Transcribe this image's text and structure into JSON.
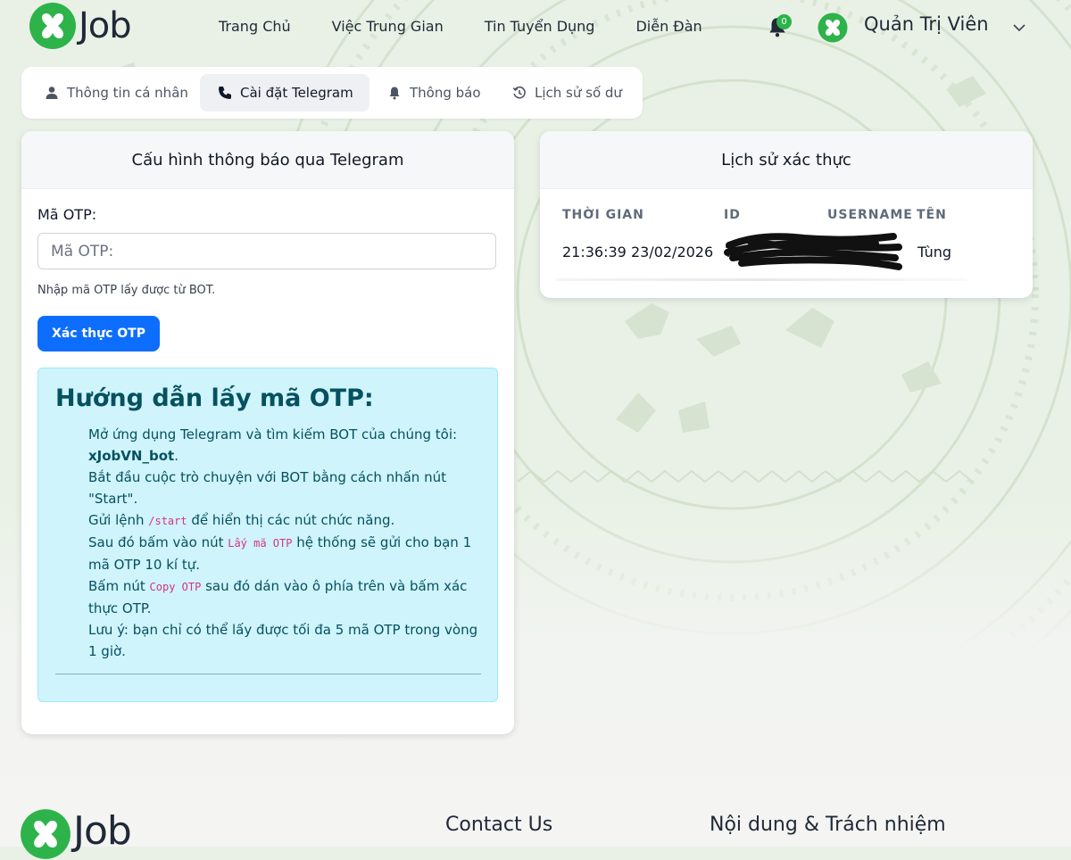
{
  "brand": {
    "logo_text": "Job",
    "accent": "#2db34a"
  },
  "nav": {
    "links": [
      "Trang Chủ",
      "Việc Trung Gian",
      "Tin Tuyển Dụng",
      "Diễn Đàn"
    ],
    "notification_count": "0",
    "user_name": "Quản Trị Viên",
    "icons": {
      "bell": "bell-icon",
      "dropdown": "chevron-down-icon",
      "avatar": "x-avatar-icon"
    }
  },
  "tabs": [
    {
      "label": "Thông tin cá nhân",
      "icon": "user-icon",
      "active": false
    },
    {
      "label": "Cài đặt Telegram",
      "icon": "phone-icon",
      "active": true
    },
    {
      "label": "Thông báo",
      "icon": "bell-icon",
      "active": false
    },
    {
      "label": "Lịch sử số dư",
      "icon": "history-icon",
      "active": false
    }
  ],
  "otp_card": {
    "title": "Cấu hình thông báo qua Telegram",
    "field_label": "Mã OTP:",
    "placeholder": "Mã OTP:",
    "value": "",
    "hint": "Nhập mã OTP lấy được từ BOT.",
    "button": "Xác thực OTP",
    "guide": {
      "title": "Hướng dẫn lấy mã OTP:",
      "steps": [
        {
          "text": "Mở ứng dụng Telegram và tìm kiếm BOT của chúng tôi:",
          "bold": "xJobVN_bot",
          "after": "."
        },
        {
          "text": "Bắt đầu cuộc trò chuyện với BOT bằng cách nhấn nút \"Start\"."
        },
        {
          "before": "Gửi lệnh ",
          "code": "/start",
          "after": " để hiển thị các nút chức năng."
        },
        {
          "before": "Sau đó bấm vào nút ",
          "code": "Lấy mã OTP",
          "after": " hệ thống sẽ gửi cho bạn 1 mã OTP 10 kí tự."
        },
        {
          "before": "Bấm nút ",
          "code": "Copy OTP",
          "after": " sau đó dán vào ô phía trên và bấm xác thực OTP."
        },
        {
          "text": "Lưu ý: bạn chỉ có thể lấy được tối đa 5 mã OTP trong vòng 1 giờ."
        }
      ]
    }
  },
  "history_card": {
    "title": "Lịch sử xác thực",
    "columns": [
      "THỜI GIAN",
      "ID",
      "USERNAME",
      "TÊN"
    ],
    "rows": [
      {
        "time": "21:36:39 23/02/2026",
        "id": "7",
        "username": "",
        "name": "Tùng"
      }
    ]
  },
  "footer": {
    "logo_text": "Job",
    "headings": [
      "Contact Us",
      "Nội dung & Trách nhiệm"
    ]
  }
}
